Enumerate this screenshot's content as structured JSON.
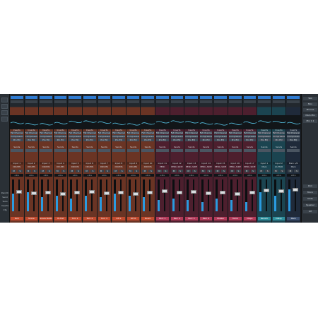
{
  "colors": {
    "bg": "#1c2126",
    "orange": "#6a3424",
    "red": "#4d1f2e",
    "teal": "#1b4450",
    "navy": "#1f2a3a",
    "blue_btn": "#2f7bd1",
    "meter": "#2a9be0"
  },
  "left_panel": {
    "labels": [
      "Pan/Ch",
      "Send",
      "Tools",
      "Inserts",
      "Cfg"
    ]
  },
  "channels": [
    {
      "color": "orange",
      "input": "Input 1",
      "name": "DRUMS",
      "bottom": "Kick"
    },
    {
      "color": "orange",
      "input": "Input 2",
      "name": "DRUMS",
      "bottom": "Snare"
    },
    {
      "color": "orange",
      "input": "Input 3",
      "name": "DRUMS",
      "bottom": "Snare Bottom"
    },
    {
      "color": "orange",
      "input": "Input 4",
      "name": "DRUMS",
      "bottom": "Hi-Hat"
    },
    {
      "color": "orange",
      "input": "Input 5",
      "name": "DRUMS",
      "bottom": "Tom 1"
    },
    {
      "color": "orange",
      "input": "Input 6",
      "name": "DRUMS",
      "bottom": "Tom 2"
    },
    {
      "color": "orange",
      "input": "Input 7",
      "name": "DRUMS",
      "bottom": "Tom 3"
    },
    {
      "color": "orange",
      "input": "Input 8",
      "name": "DRUMS",
      "bottom": "OH L"
    },
    {
      "color": "orange",
      "input": "Input 9",
      "name": "DRUMS",
      "bottom": "OH R"
    },
    {
      "color": "orange",
      "input": "Input 10",
      "name": "DRUMS",
      "bottom": "Room"
    },
    {
      "color": "red",
      "input": "Input 11",
      "name": "PERC",
      "bottom": "Perc 1"
    },
    {
      "color": "red",
      "input": "Input 12",
      "name": "PERC_SIDE",
      "bottom": "Perc 2"
    },
    {
      "color": "red",
      "input": "Input 13",
      "name": "PERC_SIDE",
      "bottom": "Perc 3"
    },
    {
      "color": "red",
      "input": "Input 14",
      "name": "PERC_SIDE",
      "bottom": "Perc 4"
    },
    {
      "color": "red",
      "input": "Input 15",
      "name": "PERC_SIDE",
      "bottom": "Shaker"
    },
    {
      "color": "red",
      "input": "Input 16",
      "name": "PERC_SIDE",
      "bottom": "Tamb"
    },
    {
      "color": "red",
      "input": "Input 17",
      "name": "PERC_SIDE",
      "bottom": "Claps"
    },
    {
      "color": "teal",
      "input": "Input 1",
      "name": "Main",
      "bottom": "Reverb"
    },
    {
      "color": "teal",
      "input": "Input 2",
      "name": "GUITAR",
      "bottom": "Delay"
    },
    {
      "color": "navy",
      "input": "Main L/R",
      "name": "Main",
      "bottom": "Main"
    }
  ],
  "strip_text": {
    "inserts": "Inserts",
    "channel_strip": "Fat Channel",
    "compressor": "Compressor",
    "pro_eq": "Pro EQ",
    "sends": "Sends",
    "pan": "<C>",
    "mute": "M",
    "solo": "S"
  },
  "right_panel": {
    "items": [
      "Talk",
      "Mon",
      "Phones",
      "Main Mix",
      "Mix 1 2",
      "Dim",
      "Mono",
      "Mute",
      "Speaker",
      "Off"
    ]
  },
  "meter_levels": [
    0.55,
    0.6,
    0.45,
    0.5,
    0.4,
    0.5,
    0.45,
    0.55,
    0.5,
    0.45,
    0.35,
    0.4,
    0.35,
    0.3,
    0.4,
    0.35,
    0.3,
    0.6,
    0.5,
    0.7
  ],
  "fader_levels": [
    0.62,
    0.58,
    0.6,
    0.55,
    0.6,
    0.62,
    0.58,
    0.6,
    0.55,
    0.6,
    0.65,
    0.6,
    0.62,
    0.58,
    0.6,
    0.55,
    0.6,
    0.66,
    0.64,
    0.7
  ]
}
